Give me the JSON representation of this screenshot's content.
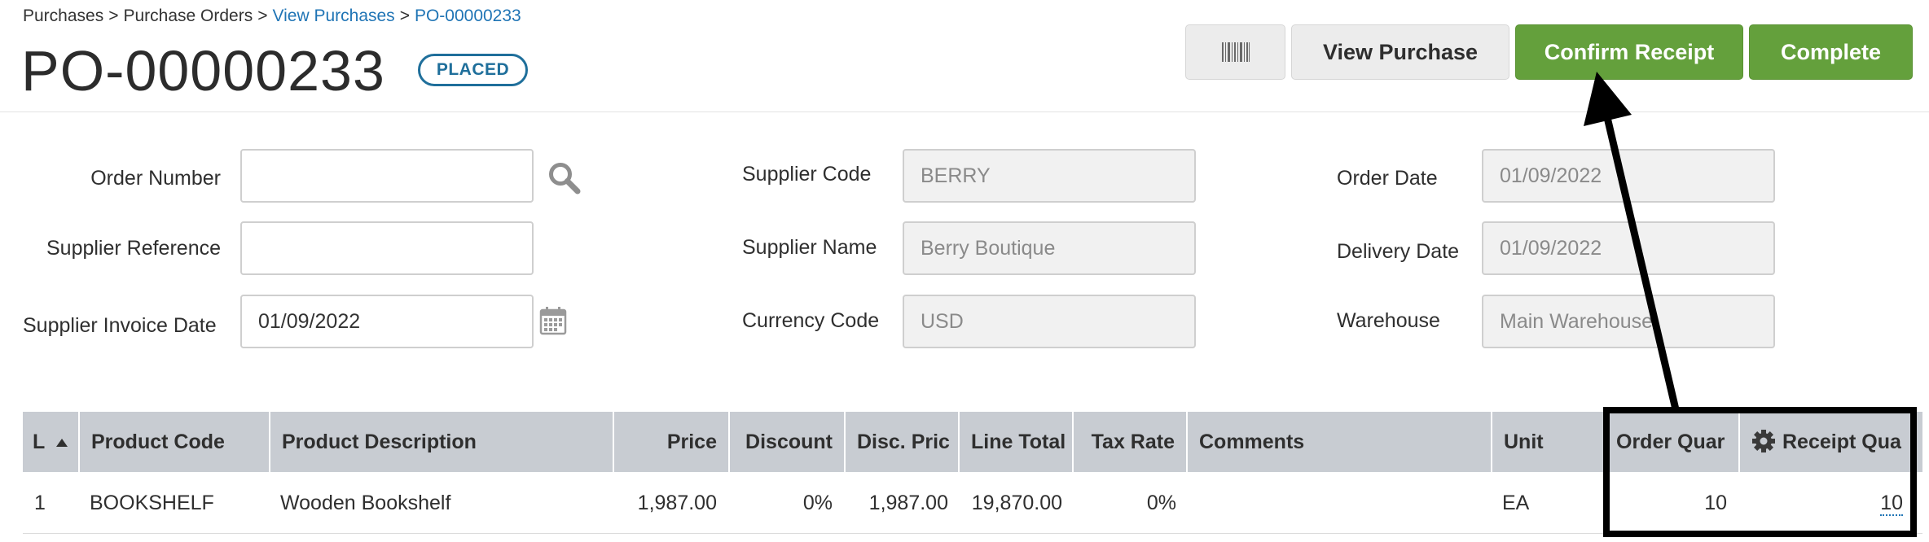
{
  "breadcrumb": {
    "items": [
      {
        "label": "Purchases",
        "link": false
      },
      {
        "label": "Purchase Orders",
        "link": false
      },
      {
        "label": "View Purchases",
        "link": true
      },
      {
        "label": "PO-00000233",
        "link": true
      }
    ],
    "separator": ">"
  },
  "header": {
    "title": "PO-00000233",
    "status": "PLACED"
  },
  "toolbar": {
    "barcode_icon": "barcode-icon",
    "view_purchase_label": "View Purchase",
    "confirm_receipt_label": "Confirm Receipt",
    "complete_label": "Complete",
    "accent_green": "#64a03c"
  },
  "form": {
    "order_number": {
      "label": "Order Number",
      "value": ""
    },
    "supplier_reference": {
      "label": "Supplier Reference",
      "value": ""
    },
    "supplier_invoice_date": {
      "label": "Supplier Invoice Date",
      "value": "01/09/2022"
    },
    "supplier_code": {
      "label": "Supplier Code",
      "value": "BERRY"
    },
    "supplier_name": {
      "label": "Supplier Name",
      "value": "Berry Boutique"
    },
    "currency_code": {
      "label": "Currency Code",
      "value": "USD"
    },
    "order_date": {
      "label": "Order Date",
      "value": "01/09/2022"
    },
    "delivery_date": {
      "label": "Delivery Date",
      "value": "01/09/2022"
    },
    "warehouse": {
      "label": "Warehouse",
      "value": "Main Warehouse"
    }
  },
  "table": {
    "columns": {
      "line": "L",
      "product_code": "Product Code",
      "product_description": "Product Description",
      "price": "Price",
      "discount": "Discount",
      "disc_price": "Disc. Pric",
      "line_total": "Line Total",
      "tax_rate": "Tax Rate",
      "comments": "Comments",
      "unit": "Unit",
      "order_qty": "Order Quar",
      "receipt_qty": "Receipt Qua"
    },
    "rows": [
      {
        "line": "1",
        "product_code": "BOOKSHELF",
        "product_description": "Wooden Bookshelf",
        "price": "1,987.00",
        "discount": "0%",
        "disc_price": "1,987.00",
        "line_total": "19,870.00",
        "tax_rate": "0%",
        "comments": "",
        "unit": "EA",
        "order_qty": "10",
        "receipt_qty": "10"
      }
    ]
  }
}
